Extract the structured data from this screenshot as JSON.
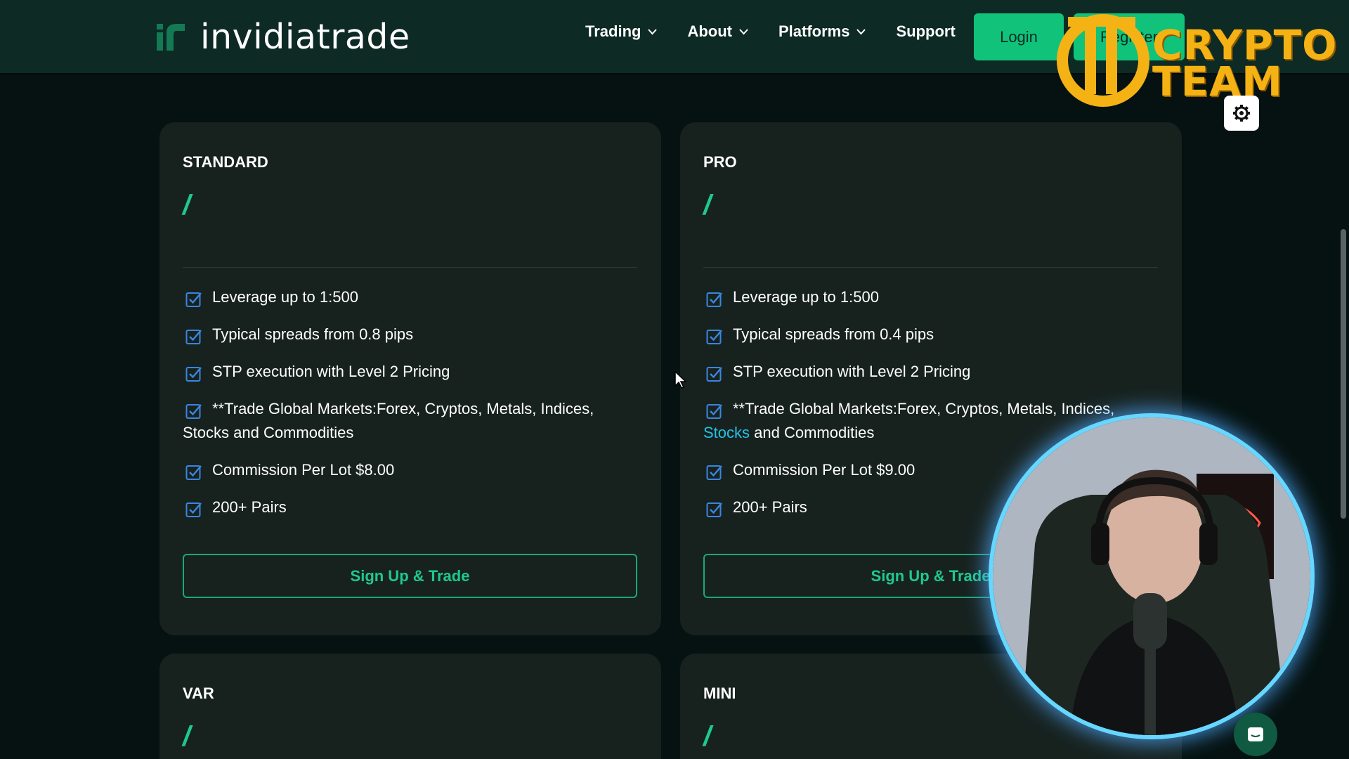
{
  "header": {
    "logo_text": "invidiatrade",
    "nav": [
      {
        "label": "Trading"
      },
      {
        "label": "About"
      },
      {
        "label": "Platforms"
      },
      {
        "label": "Support"
      }
    ],
    "login_label": "Login",
    "register_label": "Register"
  },
  "overlay": {
    "crypto_line1": "CRYPTO",
    "crypto_line2": "TEAM"
  },
  "cards": [
    {
      "title": "STANDARD",
      "slash": "/",
      "features": [
        {
          "text": "Leverage up to 1:500"
        },
        {
          "text": "Typical spreads from 0.8 pips"
        },
        {
          "text": "STP execution with Level 2 Pricing"
        },
        {
          "text": "**Trade Global Markets:Forex, Cryptos, Metals, Indices, Stocks and Commodities"
        },
        {
          "text": "Commission Per Lot $8.00"
        },
        {
          "text": "200+ Pairs"
        }
      ],
      "button": "Sign Up & Trade"
    },
    {
      "title": "PRO",
      "slash": "/",
      "features": [
        {
          "text": "Leverage up to 1:500"
        },
        {
          "text": "Typical spreads from 0.4 pips"
        },
        {
          "text": "STP execution with Level 2 Pricing"
        },
        {
          "text_a": "**Trade Global Markets:Forex, Cryptos, Metals, Indices, ",
          "link": "Stocks",
          "text_b": " and Commodities"
        },
        {
          "text": "Commission Per Lot $9.00"
        },
        {
          "text": "200+ Pairs"
        }
      ],
      "button": "Sign Up & Trade"
    },
    {
      "title": "VAR",
      "slash": "/"
    },
    {
      "title": "MINI",
      "slash": "/"
    }
  ],
  "colors": {
    "accent": "#10c27a",
    "header_bg": "#0d2a24",
    "page_bg": "#061211",
    "card_bg": "#17221f",
    "check": "#3a86e0",
    "link": "#25c2e8"
  }
}
